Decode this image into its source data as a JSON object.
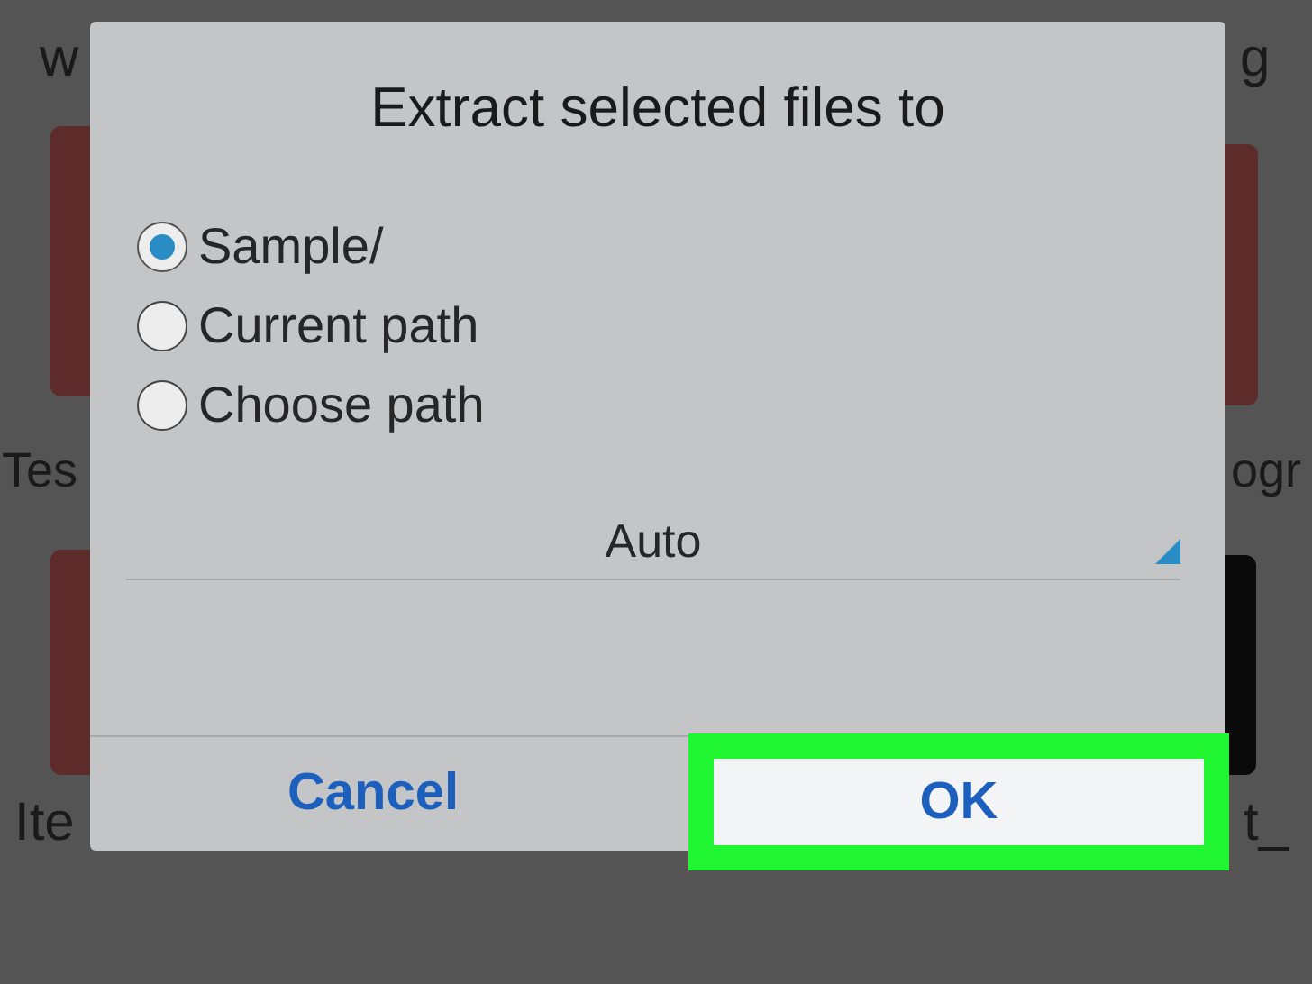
{
  "background": {
    "labels": [
      {
        "text": "w"
      },
      {
        "text": "g"
      },
      {
        "text": "Tes"
      },
      {
        "text": "ogr"
      },
      {
        "text": "Ite"
      },
      {
        "text": "t_"
      }
    ]
  },
  "dialog": {
    "title": "Extract selected files to",
    "options": [
      {
        "label": "Sample/",
        "selected": true
      },
      {
        "label": "Current path",
        "selected": false
      },
      {
        "label": "Choose path",
        "selected": false
      }
    ],
    "dropdown": {
      "value": "Auto"
    },
    "buttons": [
      {
        "label": "Cancel",
        "highlighted": false
      },
      {
        "label": "OK",
        "highlighted": true
      }
    ]
  }
}
